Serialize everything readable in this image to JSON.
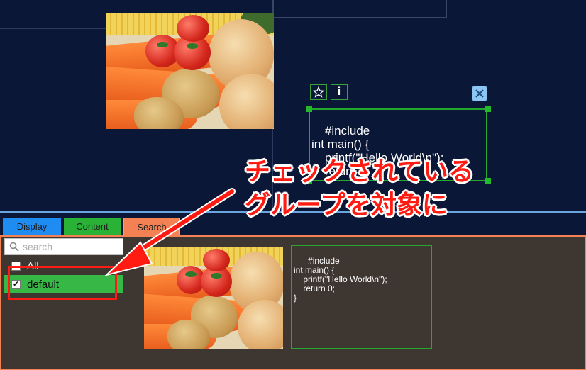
{
  "canvas": {
    "code_text": "#include\nint main() {\n    printf(\"Hello World\\n\");\n    return 0;\n}",
    "star_icon": "star-icon",
    "info_label": "i",
    "close_icon": "close-icon"
  },
  "annotation": {
    "line1": "チェックされている",
    "line2": "グループを対象に"
  },
  "tabs": [
    {
      "label": "Display",
      "color": "#1f8cf2"
    },
    {
      "label": "Content",
      "color": "#29b236"
    },
    {
      "label": "Search",
      "color": "#f48154"
    }
  ],
  "search": {
    "placeholder": "search"
  },
  "groups": [
    {
      "label": "All",
      "checked": false
    },
    {
      "label": "default",
      "checked": true
    }
  ],
  "results": {
    "code_text": "#include\nint main() {\n    printf(\"Hello World\\n\");\n    return 0;\n}"
  },
  "colors": {
    "canvas_bg": "#0b1736",
    "panel_bg": "#3e3630",
    "accent_green": "#24a82d",
    "annotation_red": "#ff1a12"
  }
}
